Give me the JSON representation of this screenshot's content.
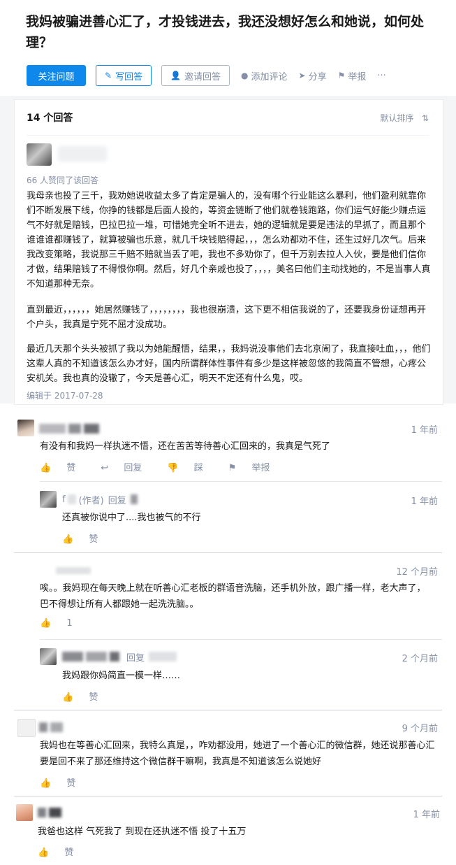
{
  "question": {
    "title": "我妈被骗进善心汇了，才投钱进去，我还没想好怎么和她说，如何处理？"
  },
  "actions": {
    "follow": "关注问题",
    "write": "写回答",
    "invite": "邀请回答",
    "comment": "添加评论",
    "share": "分享",
    "report": "举报",
    "more": "···"
  },
  "answers_header": {
    "count": "14 个回答",
    "sort": "默认排序"
  },
  "answer": {
    "likes": "66 人赞同了该回答",
    "paragraphs": [
      "我母亲也投了三千，我劝她说收益太多了肯定是骗人的，没有哪个行业能这么暴利，他们盈利就靠你们不断发展下线，你挣的钱都是后面人投的，等资金链断了他们就卷钱跑路，你们运气好能少赚点运气不好就是赔钱，巴拉巴拉一堆，可惜她完全听不进去，她的逻辑就是要是违法的早抓了，而且那个谁谁谁都赚钱了，就算被骗也乐意，就几千块钱赔得起，，，怎么劝都劝不住，还生过好几次气。后来我改变策略，我说那三千赔不赔就当丢了吧，我也不多劝你了，但千万别去拉人入伙，要是他们信你才做，结果赔钱了不得恨你啊。然后，好几个亲戚也投了，，，，美名曰他们主动找她的，不是当事人真不知道那种无奈。",
      "直到最近，，，，，，她居然赚钱了，，，，，，，，我也很崩溃，这下更不相信我说的了，还要我身份证想再开个户头，我真是宁死不屈才没成功。",
      "最近几天那个头头被抓了我以为她能醒悟，结果，，我妈说没事他们去北京闹了，我直接吐血，，，他们这辈人真的不知道该怎么办才好，国内所谓群体性事件有多少是这样被忽悠的我简直不管想，心疼公安机关。我也真的没辙了，今天是善心汇，明天不定还有什么鬼，哎。"
    ],
    "edited": "编辑于 2017-07-28"
  },
  "comments": [
    {
      "time": "1 年前",
      "text": "有没有和我妈一样执迷不悟，还在苦苦等待善心汇回来的，我真是气死了",
      "actions": {
        "like": "赞",
        "reply": "回复",
        "dislike": "踩",
        "report": "举报"
      },
      "replies": [
        {
          "name_initial": "f",
          "author_tag": "(作者)",
          "reply_word": "回复",
          "time": "1 年前",
          "text": "还真被你说中了....我也被气的不行",
          "like": "赞"
        }
      ]
    },
    {
      "time": "12 个月前",
      "text": "唉。。我妈现在每天晚上就在听善心汇老板的群语音洗脑，还手机外放，跟广播一样，老大声了，巴不得想让所有人都跟她一起洗洗脑。。",
      "like_count": "1",
      "replies": [
        {
          "reply_word": "回复",
          "time": "2 个月前",
          "text": "我妈跟你妈简直一模一样……",
          "like": "赞"
        }
      ]
    },
    {
      "time": "9 个月前",
      "text": "我妈也在等善心汇回来，我特么真是，，咋劝都没用，她进了一个善心汇的微信群，她还说那善心汇要是回不来了那还维持这个微信群干嘛啊，我真是不知道该怎么说她好",
      "like": "赞"
    },
    {
      "time": "1 年前",
      "text": "我爸也这样 气死我了 到现在还执迷不悟 投了十五万",
      "like": "赞"
    }
  ]
}
